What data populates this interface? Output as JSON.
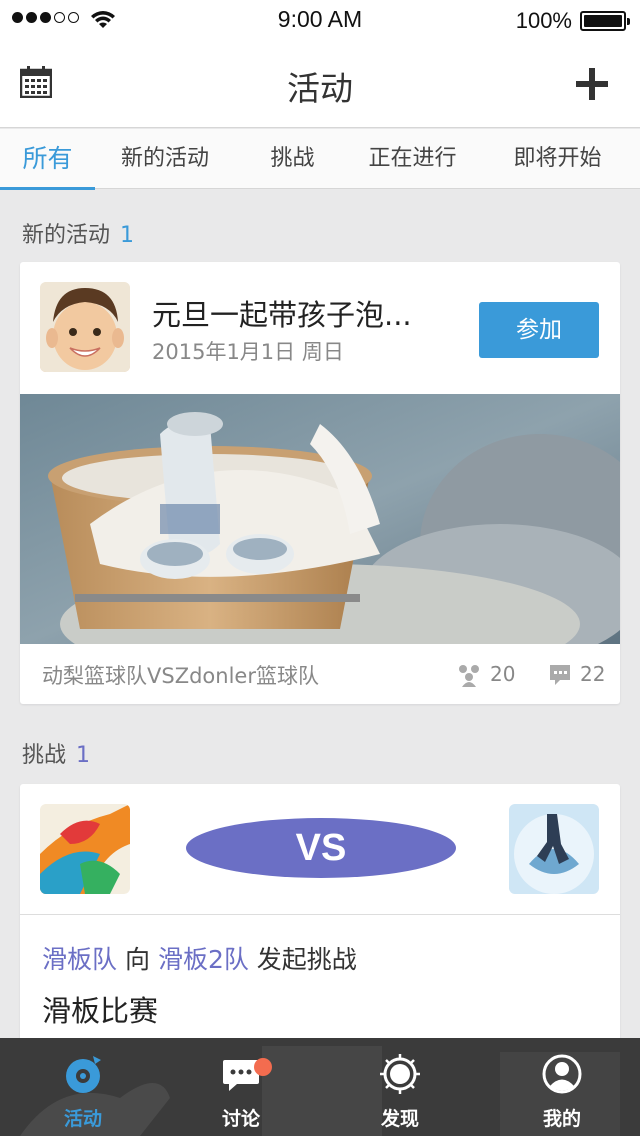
{
  "status_bar": {
    "time": "9:00 AM",
    "battery": "100%"
  },
  "nav": {
    "title": "活动"
  },
  "tabs": [
    {
      "label": "所有",
      "active": true
    },
    {
      "label": "新的活动",
      "active": false
    },
    {
      "label": "挑战",
      "active": false
    },
    {
      "label": "正在进行",
      "active": false
    },
    {
      "label": "即将开始",
      "active": false
    }
  ],
  "sections": {
    "new_events": {
      "label": "新的活动",
      "count": "1"
    },
    "challenges": {
      "label": "挑战",
      "count": "1"
    }
  },
  "event_card": {
    "title": "元旦一起带孩子泡...",
    "date": "2015年1月1日  周日",
    "join_label": "参加",
    "organizer": "动梨篮球队VSZdonler篮球队",
    "participants": "20",
    "comments": "22"
  },
  "challenge_card": {
    "vs_label": "VS",
    "team_a": "滑板队",
    "connector": "向",
    "team_b": "滑板2队",
    "action": "发起挑战",
    "title": "滑板比赛"
  },
  "tab_bar": [
    {
      "label": "活动",
      "icon": "activity-icon",
      "active": true
    },
    {
      "label": "讨论",
      "icon": "chat-icon",
      "active": false,
      "badge": true
    },
    {
      "label": "发现",
      "icon": "discover-icon",
      "active": false
    },
    {
      "label": "我的",
      "icon": "profile-icon",
      "active": false
    }
  ],
  "colors": {
    "accent": "#3a9ad9",
    "challenge": "#6b6fc5",
    "badge": "#f36c4f"
  }
}
